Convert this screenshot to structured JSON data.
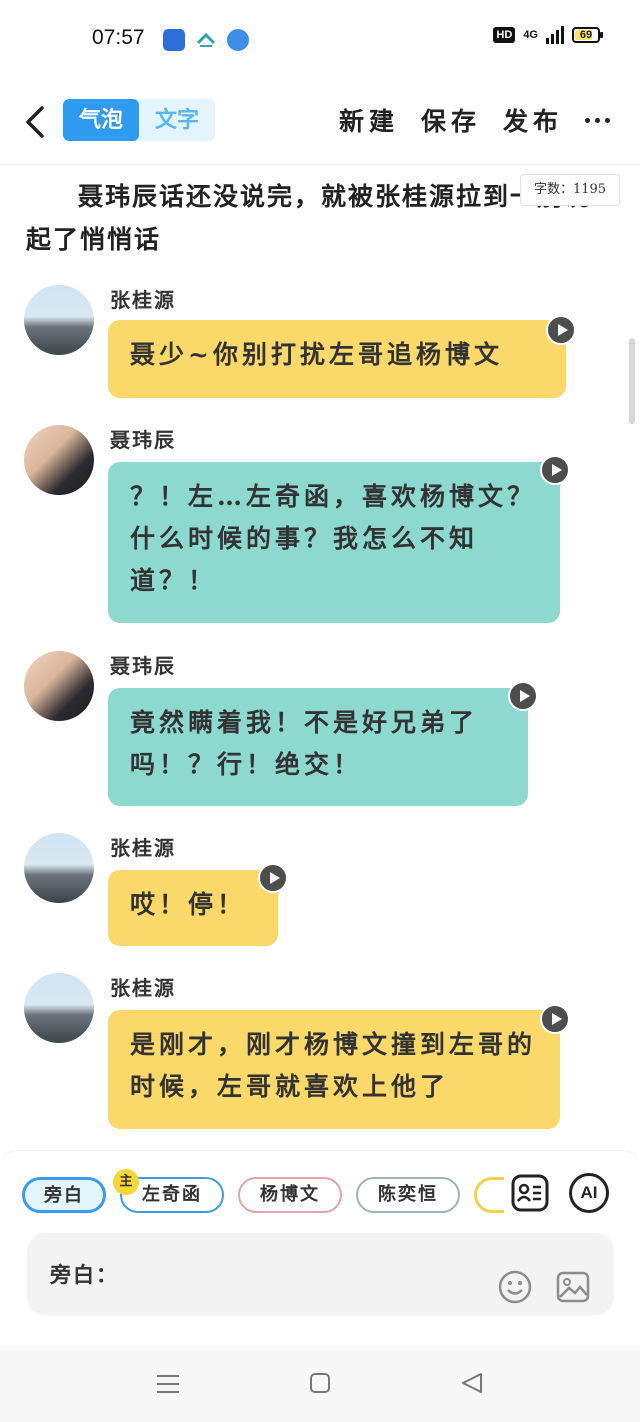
{
  "status_bar": {
    "time": "07:57",
    "hd": "HD",
    "network": "4G",
    "battery": "69"
  },
  "header": {
    "tabs": [
      {
        "label": "气泡",
        "active": true
      },
      {
        "label": "文字",
        "active": false
      }
    ],
    "actions": {
      "new": "新建",
      "save": "保存",
      "publish": "发布"
    }
  },
  "narration": "聂玮辰话还没说完，就被张桂源拉到一别说起了悄悄话",
  "word_count": "字数：1195",
  "messages": [
    {
      "speaker": "张桂源",
      "text": "聂少~你别打扰左哥追杨博文",
      "color": "#fbd86a"
    },
    {
      "speaker": "聂玮辰",
      "text": "？！左…左奇函，喜欢杨博文？什么时候的事？我怎么不知道？！",
      "color": "#8dd9d0"
    },
    {
      "speaker": "聂玮辰",
      "text": "竟然瞒着我！不是好兄弟了吗！？行！绝交！",
      "color": "#8dd9d0"
    },
    {
      "speaker": "张桂源",
      "text": "哎！停！",
      "color": "#fbd86a"
    },
    {
      "speaker": "张桂源",
      "text": "是刚才，刚才杨博文撞到左哥的时候，左哥就喜欢上他了",
      "color": "#fbd86a"
    }
  ],
  "roles": [
    {
      "label": "旁白",
      "selected": true
    },
    {
      "label": "左奇函",
      "badge": "主"
    },
    {
      "label": "杨博文"
    },
    {
      "label": "陈奕恒"
    }
  ],
  "ai_button": "AI",
  "input": {
    "label": "旁白："
  },
  "icons": [
    "back-icon",
    "play-icon",
    "more-icon",
    "role-card-icon",
    "emoji-icon",
    "image-icon",
    "nav-menu-icon",
    "nav-home-icon",
    "nav-back-icon"
  ]
}
